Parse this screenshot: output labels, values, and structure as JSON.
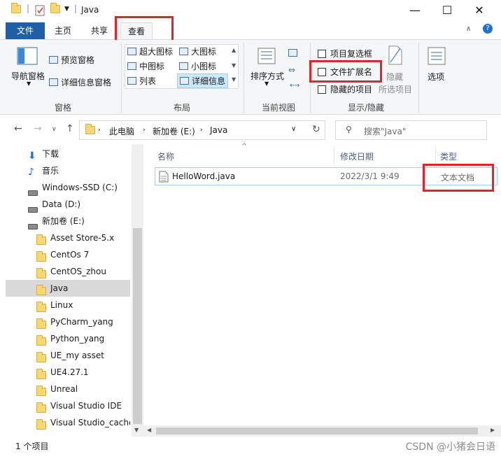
{
  "window": {
    "title": "Java",
    "minimize": "—",
    "maximize": "☐",
    "close": "✕"
  },
  "ribbon_tabs": {
    "file": "文件",
    "home": "主页",
    "share": "共享",
    "view": "查看"
  },
  "pane_group": {
    "nav_pane": "导航窗格",
    "preview_pane": "预览窗格",
    "details_pane": "详细信息窗格",
    "label": "窗格"
  },
  "layout_group": {
    "items": [
      "超大图标",
      "大图标",
      "中图标",
      "小图标",
      "列表",
      "详细信息"
    ],
    "label": "布局"
  },
  "current_view_group": {
    "sort_by": "排序方式",
    "label": "当前视图"
  },
  "show_hide_group": {
    "item_checkboxes": "项目复选框",
    "file_extensions": "文件扩展名",
    "hidden_items": "隐藏的项目",
    "hide_selected_1": "隐藏",
    "hide_selected_2": "所选项目",
    "label": "显示/隐藏"
  },
  "options": "选项",
  "address": {
    "crumbs": [
      "此电脑",
      "新加卷 (E:)",
      "Java"
    ],
    "search_placeholder": "搜索\"Java\""
  },
  "nav_items": [
    {
      "label": "下载",
      "icon": "download-icon"
    },
    {
      "label": "音乐",
      "icon": "music-icon"
    },
    {
      "label": "Windows-SSD (C:)",
      "icon": "drive-icon"
    },
    {
      "label": "Data (D:)",
      "icon": "drive-icon"
    },
    {
      "label": "新加卷 (E:)",
      "icon": "drive-icon"
    },
    {
      "label": "Asset Store-5.x",
      "icon": "folder-icon"
    },
    {
      "label": "CentOs 7",
      "icon": "folder-icon"
    },
    {
      "label": "CentOS_zhou",
      "icon": "folder-icon"
    },
    {
      "label": "Java",
      "icon": "folder-icon",
      "selected": true
    },
    {
      "label": "Linux",
      "icon": "folder-icon"
    },
    {
      "label": "PyCharm_yang",
      "icon": "folder-icon"
    },
    {
      "label": "Python_yang",
      "icon": "folder-icon"
    },
    {
      "label": "UE_my asset",
      "icon": "folder-icon"
    },
    {
      "label": "UE4.27.1",
      "icon": "folder-icon"
    },
    {
      "label": "Unreal",
      "icon": "folder-icon"
    },
    {
      "label": "Visual Studio IDE",
      "icon": "folder-icon"
    },
    {
      "label": "Visual Studio_cache",
      "icon": "folder-icon"
    }
  ],
  "columns": {
    "name": "名称",
    "modified": "修改日期",
    "type": "类型"
  },
  "files": [
    {
      "name": "HelloWord.java",
      "modified": "2022/3/1 9:49",
      "type": "文本文档"
    }
  ],
  "status": {
    "count": "1 个项目",
    "watermark": "CSDN @小猪会日语"
  },
  "colors": {
    "accent": "#1e5fa8",
    "highlight_box": "#e8212b"
  }
}
